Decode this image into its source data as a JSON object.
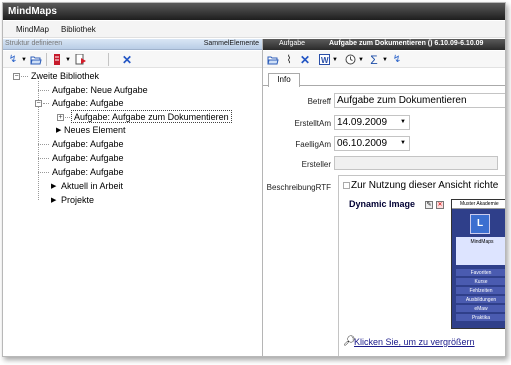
{
  "window": {
    "title": "MindMaps"
  },
  "menu": [
    {
      "label": "MindMap"
    },
    {
      "label": "Bibliothek"
    }
  ],
  "left_panel": {
    "header_title": "Struktur definieren",
    "header_right": "SammelElemente"
  },
  "right_panel": {
    "header_label": "Aufgabe",
    "header_title": "Aufgabe zum Dokumentieren () 6.10.09-6.10.09"
  },
  "tree": {
    "root": "Zweite Bibliothek",
    "items": [
      {
        "label": "Aufgabe: Neue Aufgabe"
      },
      {
        "label": "Aufgabe: Aufgabe"
      },
      {
        "label": "Aufgabe: Aufgabe zum Dokumentieren"
      },
      {
        "label": "Neues Element"
      },
      {
        "label": "Aufgabe: Aufgabe"
      },
      {
        "label": "Aufgabe: Aufgabe"
      },
      {
        "label": "Aufgabe: Aufgabe"
      },
      {
        "label": "Aktuell in Arbeit"
      },
      {
        "label": "Projekte"
      }
    ]
  },
  "tabs": [
    {
      "label": "Info"
    }
  ],
  "form": {
    "betreff_label": "Betreff",
    "betreff_value": "Aufgabe zum Dokumentieren",
    "erstellt_label": "ErstelltAm",
    "erstellt_value": "14.09.2009",
    "faellig_label": "FaelligAm",
    "faellig_value": "06.10.2009",
    "ersteller_label": "Ersteller",
    "ersteller_value": "",
    "beschreibung_label": "BeschreibungRTF"
  },
  "rtf": {
    "intro_text": "Zur Nutzung dieser Ansicht richte",
    "dynamic_image_label": "Dynamic Image",
    "zoom_link": "Klicken Sie, um zu vergrößern",
    "thumbnail": {
      "title": "Muster Akademie",
      "logo": "L",
      "app": "MindMaps",
      "items": [
        "Favoriten",
        "Kurse",
        "Fehlzeiten",
        "Ausbildungen",
        "eMaw",
        "Praktika"
      ]
    }
  },
  "icons": {
    "left_toolbar": [
      "refresh-icon",
      "folder-open-icon",
      "list-icon",
      "delete-page-icon",
      "close-icon"
    ],
    "right_toolbar": [
      "folder-open-icon",
      "paperclip-icon",
      "close-icon",
      "word-icon",
      "clock-icon",
      "sum-icon",
      "refresh-icon"
    ]
  }
}
